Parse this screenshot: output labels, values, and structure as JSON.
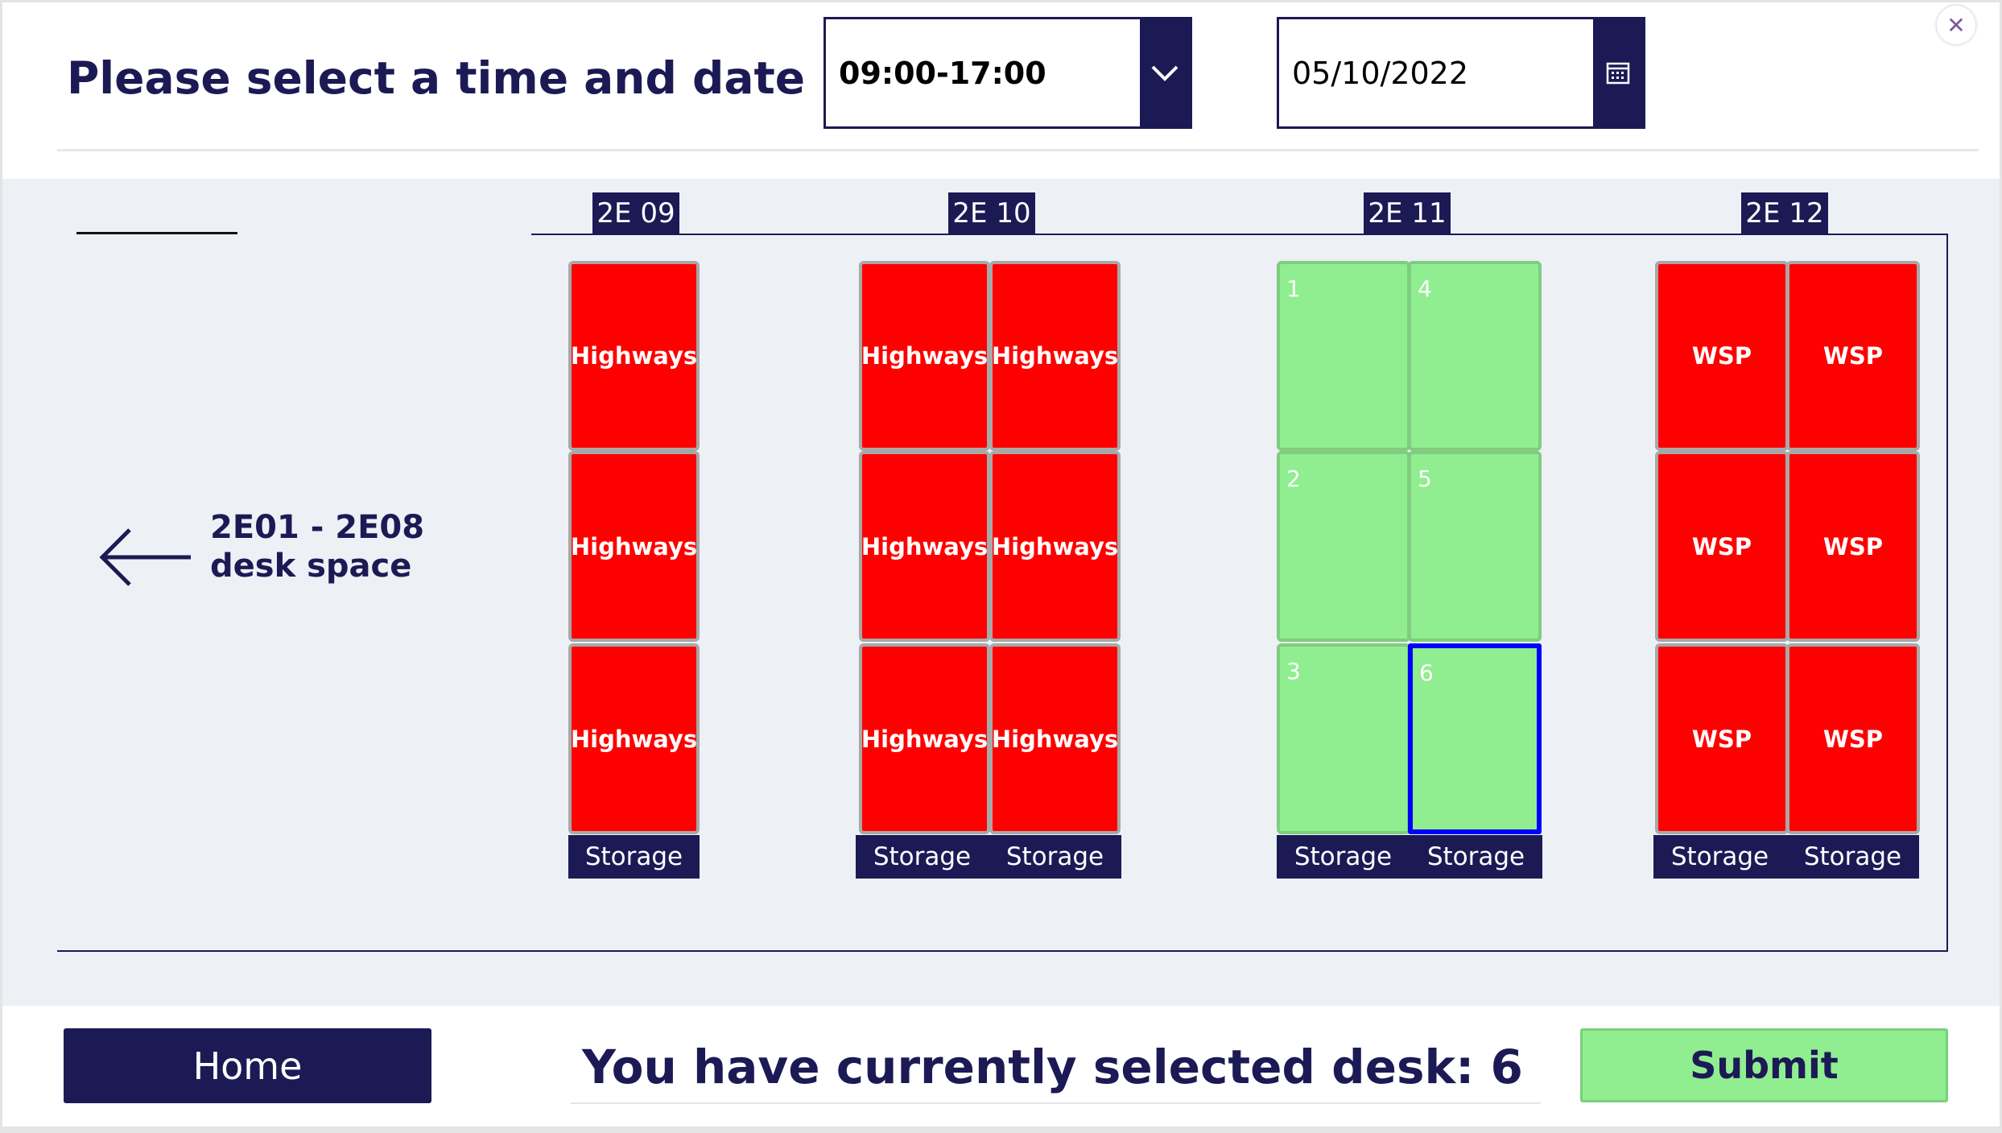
{
  "header": {
    "title": "Please select a time and date",
    "time_value": "09:00-17:00",
    "time_icon": "chevron-down-icon",
    "date_value": "05/10/2022",
    "date_icon": "calendar-icon",
    "close_icon": "close-icon"
  },
  "map": {
    "nav_label_line1": "2E01 - 2E08",
    "nav_label_line2": "desk space",
    "nav_icon": "arrow-left-icon",
    "colors": {
      "booked": "#ff0000",
      "available": "#90ee90",
      "selected_border": "#0000ff",
      "navy": "#1c1a55"
    },
    "columns": [
      {
        "label": "2E 09",
        "desks": [
          [
            "Highways"
          ],
          [
            "Highways"
          ],
          [
            "Highways"
          ]
        ],
        "storage": [
          "Storage"
        ],
        "status": "booked"
      },
      {
        "label": "2E 10",
        "desks": [
          [
            "Highways",
            "Highways"
          ],
          [
            "Highways",
            "Highways"
          ],
          [
            "Highways",
            "Highways"
          ]
        ],
        "storage": [
          "Storage",
          "Storage"
        ],
        "status": "booked"
      },
      {
        "label": "2E 11",
        "desks": [
          [
            "1",
            "4"
          ],
          [
            "2",
            "5"
          ],
          [
            "3",
            "6"
          ]
        ],
        "storage": [
          "Storage",
          "Storage"
        ],
        "status": "available",
        "selected": "6"
      },
      {
        "label": "2E 12",
        "desks": [
          [
            "WSP",
            "WSP"
          ],
          [
            "WSP",
            "WSP"
          ],
          [
            "WSP",
            "WSP"
          ]
        ],
        "storage": [
          "Storage",
          "Storage"
        ],
        "status": "booked"
      }
    ]
  },
  "footer": {
    "home_label": "Home",
    "selected_text": "You have currently selected desk: 6",
    "submit_label": "Submit"
  }
}
